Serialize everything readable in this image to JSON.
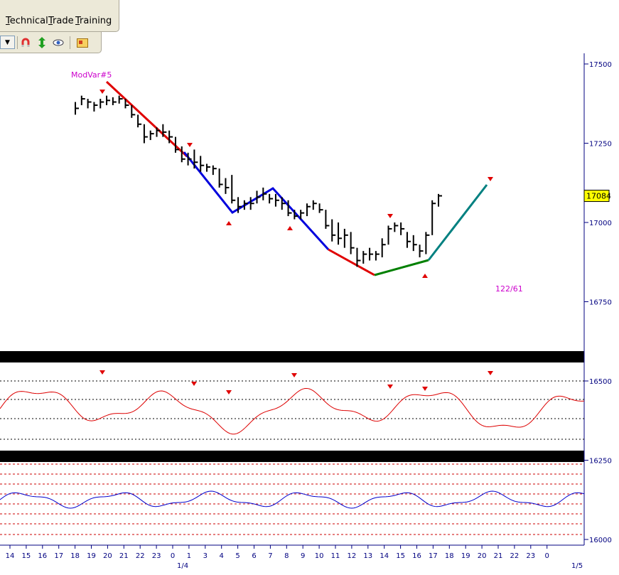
{
  "menu": {
    "items": [
      {
        "label": "Technical"
      },
      {
        "label": "Trade"
      },
      {
        "label": "Training"
      }
    ]
  },
  "toolbar": {
    "icons": [
      "dropdown-arrow",
      "magnet-icon",
      "updown-arrow-icon",
      "eye-icon",
      "chart-window-icon"
    ]
  },
  "chart_data": {
    "type": "bar",
    "price_axis": {
      "ticks": [
        "17500",
        "17250",
        "17000",
        "16750",
        "16500",
        "16250",
        "16000"
      ],
      "current_price": "17084",
      "current_price_color": "#ffff00"
    },
    "annotations": {
      "model_label": "ModVar#5",
      "ratio_label": "122/61",
      "label_color": "#cc00cc"
    },
    "time_axis": {
      "ticks": [
        "14",
        "15",
        "16",
        "17",
        "18",
        "19",
        "20",
        "21",
        "22",
        "23",
        "0",
        "1",
        "3",
        "4",
        "5",
        "6",
        "7",
        "8",
        "9",
        "10",
        "11",
        "12",
        "13",
        "14",
        "15",
        "16",
        "17",
        "18",
        "19",
        "20",
        "21",
        "22",
        "23",
        "0"
      ],
      "date_labels": [
        "1/4",
        "1/5"
      ]
    },
    "price_bars": [
      [
        17380,
        17340,
        17360
      ],
      [
        17400,
        17370,
        17390
      ],
      [
        17390,
        17360,
        17380
      ],
      [
        17380,
        17350,
        17370
      ],
      [
        17390,
        17360,
        17380
      ],
      [
        17400,
        17370,
        17385
      ],
      [
        17395,
        17370,
        17380
      ],
      [
        17400,
        17375,
        17390
      ],
      [
        17390,
        17360,
        17370
      ],
      [
        17370,
        17330,
        17340
      ],
      [
        17340,
        17300,
        17310
      ],
      [
        17310,
        17250,
        17270
      ],
      [
        17290,
        17260,
        17280
      ],
      [
        17300,
        17270,
        17290
      ],
      [
        17310,
        17270,
        17285
      ],
      [
        17290,
        17250,
        17270
      ],
      [
        17270,
        17220,
        17230
      ],
      [
        17240,
        17190,
        17200
      ],
      [
        17220,
        17180,
        17200
      ],
      [
        17230,
        17170,
        17190
      ],
      [
        17210,
        17160,
        17180
      ],
      [
        17185,
        17160,
        17175
      ],
      [
        17180,
        17150,
        17170
      ],
      [
        17170,
        17110,
        17120
      ],
      [
        17140,
        17090,
        17110
      ],
      [
        17150,
        17060,
        17070
      ],
      [
        17080,
        17030,
        17050
      ],
      [
        17070,
        17040,
        17060
      ],
      [
        17080,
        17040,
        17060
      ],
      [
        17100,
        17060,
        17080
      ],
      [
        17110,
        17070,
        17090
      ],
      [
        17090,
        17060,
        17075
      ],
      [
        17090,
        17050,
        17070
      ],
      [
        17080,
        17040,
        17060
      ],
      [
        17070,
        17020,
        17030
      ],
      [
        17040,
        17010,
        17020
      ],
      [
        17040,
        17010,
        17030
      ],
      [
        17060,
        17020,
        17050
      ],
      [
        17070,
        17040,
        17060
      ],
      [
        17060,
        17030,
        17040
      ],
      [
        17040,
        16980,
        16990
      ],
      [
        17010,
        16940,
        16960
      ],
      [
        17000,
        16930,
        16950
      ],
      [
        16980,
        16920,
        16960
      ],
      [
        16970,
        16900,
        16920
      ],
      [
        16920,
        16860,
        16880
      ],
      [
        16910,
        16870,
        16900
      ],
      [
        16920,
        16880,
        16900
      ],
      [
        16910,
        16880,
        16900
      ],
      [
        16950,
        16890,
        16930
      ],
      [
        16990,
        16930,
        16980
      ],
      [
        17000,
        16970,
        16990
      ],
      [
        17000,
        16960,
        16980
      ],
      [
        16970,
        16920,
        16940
      ],
      [
        16960,
        16910,
        16930
      ],
      [
        16930,
        16890,
        16910
      ],
      [
        16970,
        16900,
        16960
      ],
      [
        17070,
        16960,
        17060
      ],
      [
        17090,
        17050,
        17084
      ]
    ],
    "oscillator_1": {
      "color": "#dd0000",
      "levels": [
        "0.9",
        "0.6",
        "0.3",
        "0.1"
      ]
    },
    "oscillator_2": {
      "color": "#0000cc",
      "grid_color": "#cc0000"
    }
  }
}
